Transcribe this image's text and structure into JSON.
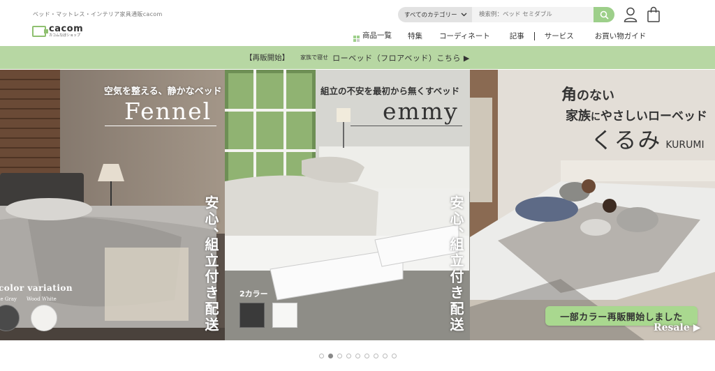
{
  "header": {
    "tagline": "ベッド・マットレス・インテリア家具通販cacom",
    "logo_word": "cacom",
    "logo_sub": "カコムなぼショップ",
    "search": {
      "category": "すべてのカテゴリー",
      "placeholder": "検索例：ベッド セミダブル"
    }
  },
  "nav": {
    "items": [
      "商品一覧",
      "特集",
      "コーディネート",
      "記事",
      "サービス",
      "お買い物ガイド"
    ]
  },
  "banner": {
    "label": "【再販開始】",
    "small": "家族で寝せ",
    "text": "ローベッド（フロアベッド）こちら ▶"
  },
  "slides": [
    {
      "subtitle": "空気を整える、静かなベッド",
      "title": "Fennel",
      "vertical_1": "安心、",
      "vertical_2": "組立付き配送",
      "variation": "color variation",
      "swatch_1": "ne Gray",
      "swatch_2": "Wood White"
    },
    {
      "subtitle": "組立の不安を最初から無くすベッド",
      "title": "emmy",
      "vertical_1": "安心、",
      "vertical_2": "組立付き配送",
      "colors_label": "2カラー"
    },
    {
      "line1_a": "角",
      "line1_b": "のない",
      "line2_a": "家族",
      "line2_b": "に",
      "line2_c": "やさしいローベッド",
      "line3_a": "くるみ",
      "line3_b": "KURUMI",
      "resale_tag": "一部カラー再販開始しました",
      "resale_en": "Resale ▶"
    }
  ],
  "carousel": {
    "count": 9,
    "active_index": 1
  },
  "colors": {
    "accent_green": "#9dcf8a",
    "banner_green": "#b7d7a3"
  }
}
